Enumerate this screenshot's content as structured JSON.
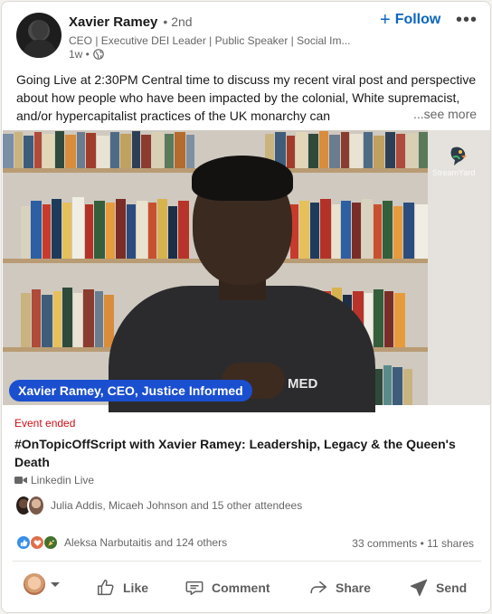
{
  "post": {
    "author_name": "Xavier Ramey",
    "connection_degree": "• 2nd",
    "headline": "CEO | Executive DEI Leader | Public Speaker | Social Im...",
    "time_ago": "1w •",
    "follow_label": "Follow",
    "more_label": "•••",
    "text": "Going Live at 2:30PM Central time to discuss my recent viral post and perspective about how people who have been impacted by the colonial, White supremacist, and/or hypercapitalist practices of the UK monarchy can",
    "see_more": "...see more"
  },
  "video": {
    "name_tag": "Xavier Ramey, CEO, Justice Informed",
    "watermark": "StreamYard",
    "shirt_text": "MED"
  },
  "event": {
    "status": "Event ended",
    "status_color": "#cc1016",
    "title": "#OnTopicOffScript with Xavier Ramey: Leadership, Legacy & the Queen's Death",
    "type": "Linkedin Live",
    "attendees": "Julia Addis, Micaeh Johnson and 15 other attendees"
  },
  "social": {
    "reactions": "Aleksa Narbutaitis and 124 others",
    "counts": "33 comments • 11 shares",
    "reaction_icons": [
      "like-icon",
      "love-icon",
      "celebrate-icon"
    ]
  },
  "actions": {
    "like": "Like",
    "comment": "Comment",
    "share": "Share",
    "send": "Send"
  },
  "colors": {
    "accent": "#0a66c2",
    "name_tag_bg": "#1a4fcf"
  }
}
